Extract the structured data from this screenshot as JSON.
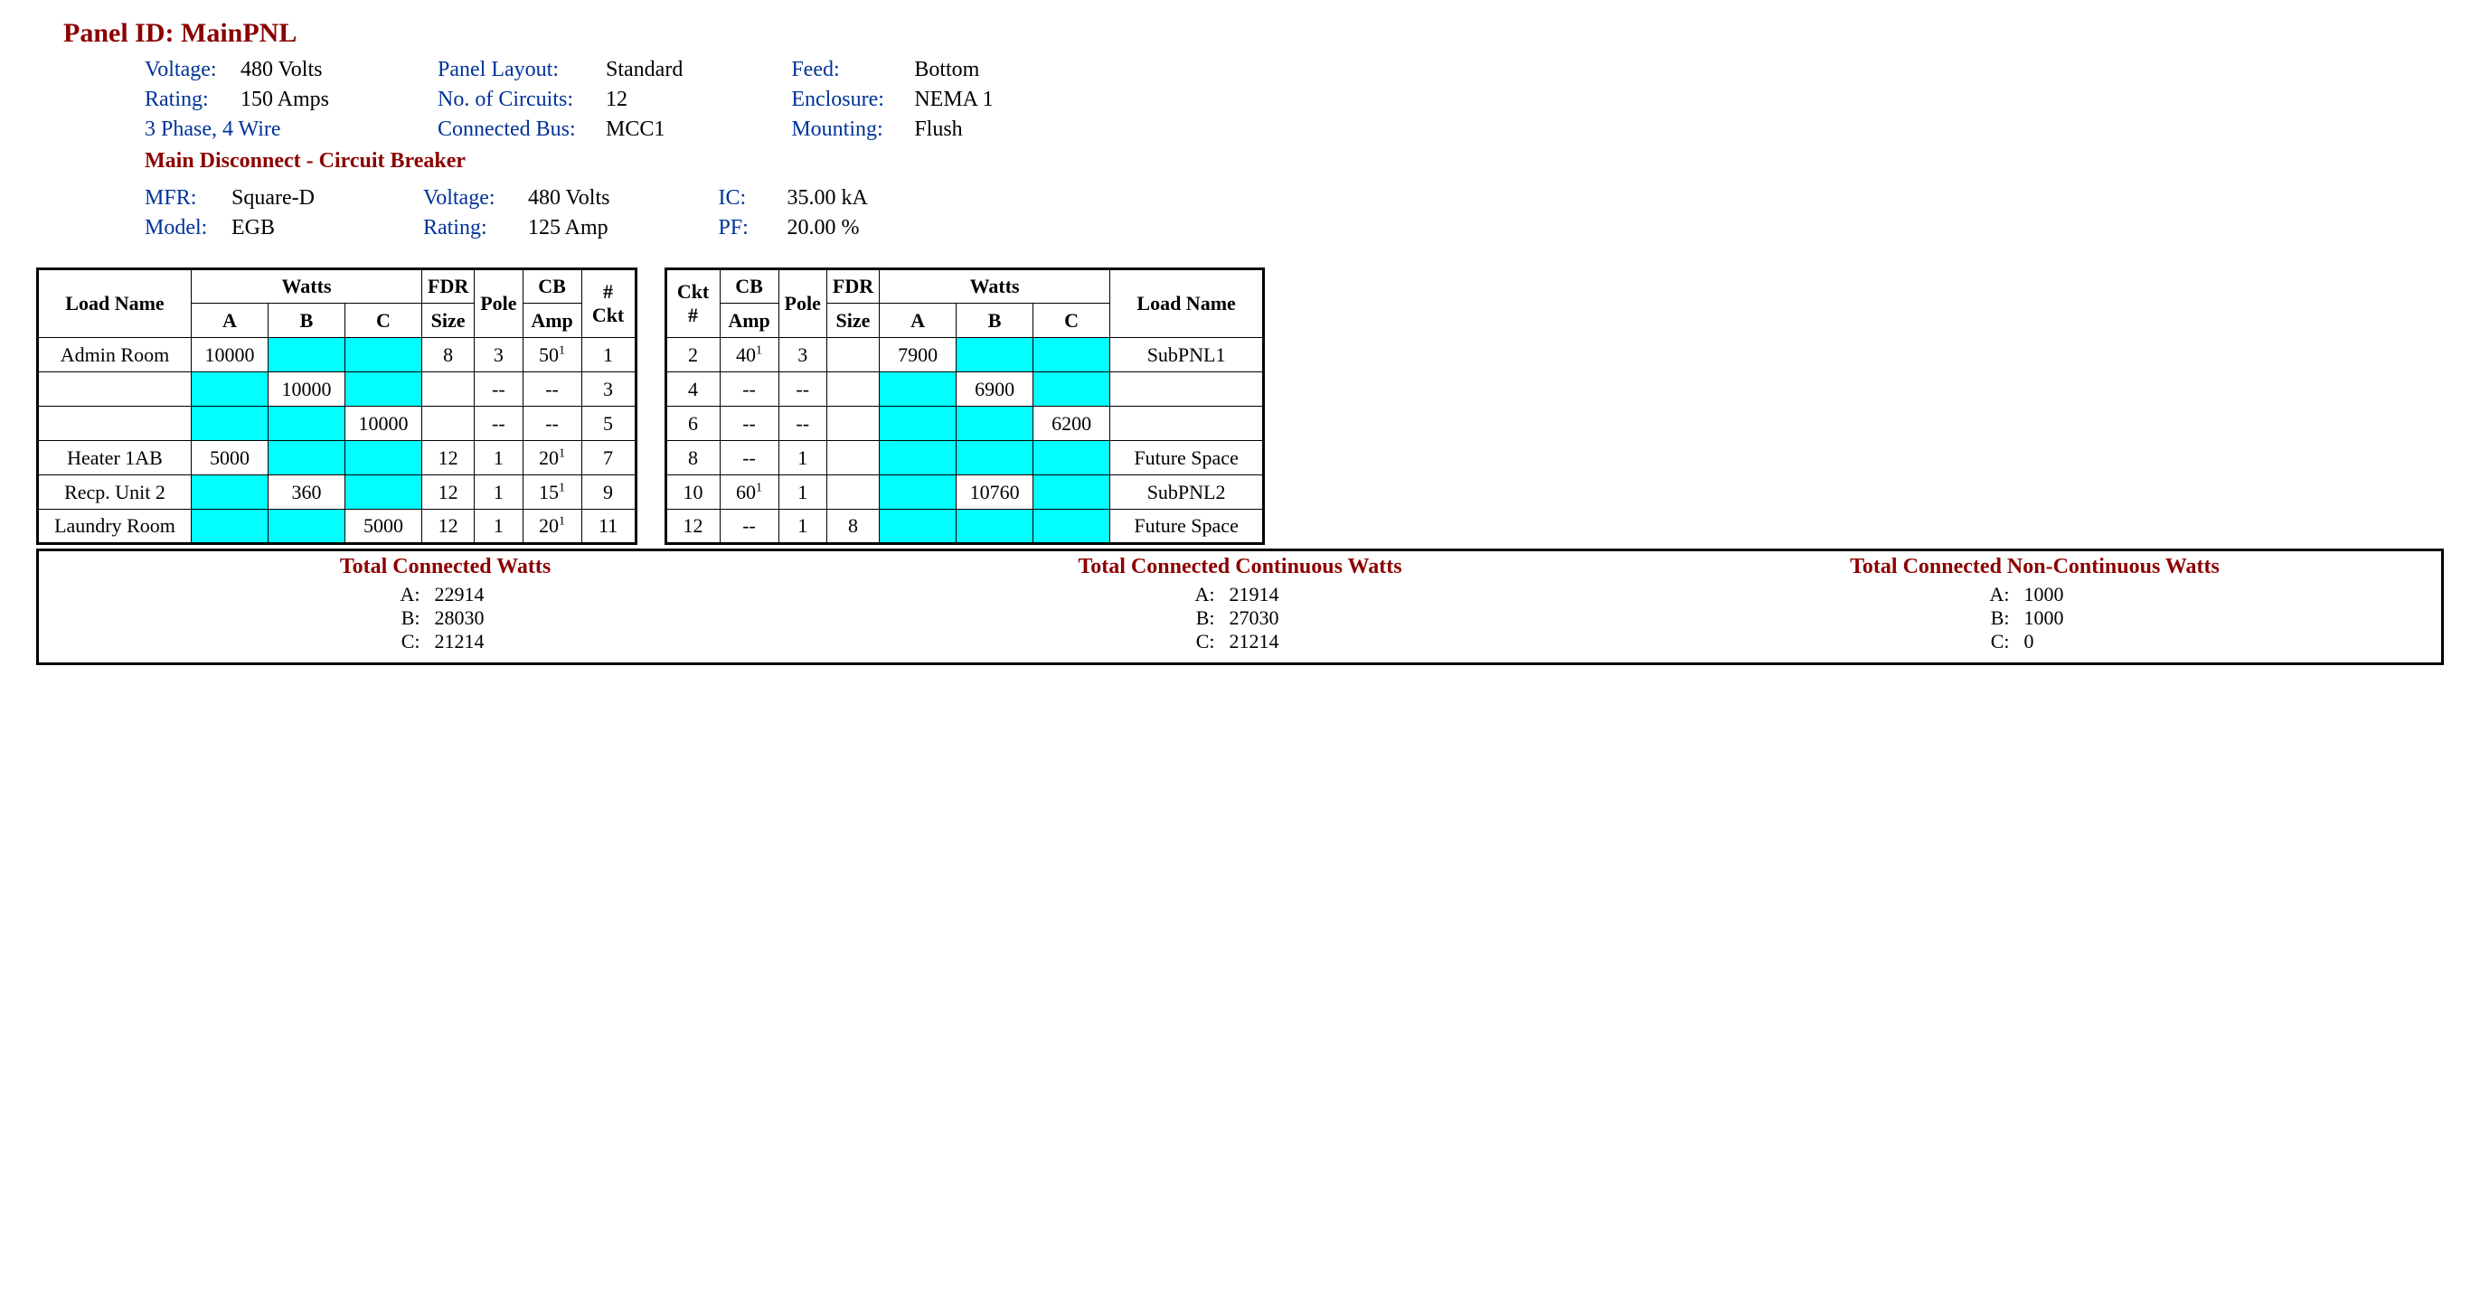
{
  "title_prefix": "Panel ID:  ",
  "title_value": "MainPNL",
  "header": {
    "col1": {
      "voltage_label": "Voltage:",
      "voltage_value": "480 Volts",
      "rating_label": "Rating:",
      "rating_value": "150 Amps",
      "phase_wire": "3 Phase, 4 Wire"
    },
    "col2": {
      "layout_label": "Panel Layout:",
      "layout_value": "Standard",
      "circuits_label": "No. of Circuits:",
      "circuits_value": "12",
      "bus_label": "Connected Bus:",
      "bus_value": "MCC1"
    },
    "col3": {
      "feed_label": "Feed:",
      "feed_value": "Bottom",
      "enclosure_label": "Enclosure:",
      "enclosure_value": "NEMA 1",
      "mounting_label": "Mounting:",
      "mounting_value": "Flush"
    }
  },
  "disconnect_title": "Main Disconnect - Circuit Breaker",
  "disconnect": {
    "col1": {
      "mfr_label": "MFR:",
      "mfr_value": "Square-D",
      "model_label": "Model:",
      "model_value": "EGB"
    },
    "col2": {
      "voltage_label": "Voltage:",
      "voltage_value": "480 Volts",
      "rating_label": "Rating:",
      "rating_value": "125 Amp"
    },
    "col3": {
      "ic_label": "IC:",
      "ic_value": "35.00 kA",
      "pf_label": "PF:",
      "pf_value": "20.00 %"
    }
  },
  "table_headers": {
    "load_name": "Load Name",
    "watts": "Watts",
    "A": "A",
    "B": "B",
    "C": "C",
    "fdr": "FDR",
    "size": "Size",
    "pole": "Pole",
    "cb": "CB",
    "amp": "Amp",
    "ckt_hash": "# Ckt",
    "ckt_num": "Ckt #"
  },
  "left_rows": [
    {
      "load": "Admin Room",
      "A": "10000",
      "B": "",
      "C": "",
      "fill": "A",
      "fdr": "8",
      "pole": "3",
      "cb": "50",
      "cb_sup": "1",
      "ckt": "1"
    },
    {
      "load": "",
      "A": "",
      "B": "10000",
      "C": "",
      "fill": "B",
      "fdr": "",
      "pole": "--",
      "cb": "--",
      "cb_sup": "",
      "ckt": "3"
    },
    {
      "load": "",
      "A": "",
      "B": "",
      "C": "10000",
      "fill": "C",
      "fdr": "",
      "pole": "--",
      "cb": "--",
      "cb_sup": "",
      "ckt": "5"
    },
    {
      "load": "Heater 1AB",
      "A": "5000",
      "B": "",
      "C": "",
      "fill": "A",
      "fdr": "12",
      "pole": "1",
      "cb": "20",
      "cb_sup": "1",
      "ckt": "7"
    },
    {
      "load": "Recp. Unit 2",
      "A": "",
      "B": "360",
      "C": "",
      "fill": "B",
      "fdr": "12",
      "pole": "1",
      "cb": "15",
      "cb_sup": "1",
      "ckt": "9"
    },
    {
      "load": "Laundry Room",
      "A": "",
      "B": "",
      "C": "5000",
      "fill": "C",
      "fdr": "12",
      "pole": "1",
      "cb": "20",
      "cb_sup": "1",
      "ckt": "11"
    }
  ],
  "right_rows": [
    {
      "ckt": "2",
      "cb": "40",
      "cb_sup": "1",
      "pole": "3",
      "fdr": "",
      "A": "7900",
      "B": "",
      "C": "",
      "fill": "A",
      "load": "SubPNL1"
    },
    {
      "ckt": "4",
      "cb": "--",
      "cb_sup": "",
      "pole": "--",
      "fdr": "",
      "A": "",
      "B": "6900",
      "C": "",
      "fill": "B",
      "load": ""
    },
    {
      "ckt": "6",
      "cb": "--",
      "cb_sup": "",
      "pole": "--",
      "fdr": "",
      "A": "",
      "B": "",
      "C": "6200",
      "fill": "C",
      "load": ""
    },
    {
      "ckt": "8",
      "cb": "--",
      "cb_sup": "",
      "pole": "1",
      "fdr": "",
      "A": "",
      "B": "",
      "C": "",
      "fill": "ALL",
      "load": "Future Space"
    },
    {
      "ckt": "10",
      "cb": "60",
      "cb_sup": "1",
      "pole": "1",
      "fdr": "",
      "A": "",
      "B": "10760",
      "C": "",
      "fill": "B",
      "load": "SubPNL2"
    },
    {
      "ckt": "12",
      "cb": "--",
      "cb_sup": "",
      "pole": "1",
      "fdr": "8",
      "A": "",
      "B": "",
      "C": "",
      "fill": "ALL",
      "load": "Future Space"
    }
  ],
  "totals": {
    "connected": {
      "title": "Total Connected Watts",
      "A": "22914",
      "B": "28030",
      "C": "21214"
    },
    "continuous": {
      "title": "Total Connected Continuous Watts",
      "A": "21914",
      "B": "27030",
      "C": "21214"
    },
    "noncontinuous": {
      "title": "Total Connected Non-Continuous Watts",
      "A": "1000",
      "B": "1000",
      "C": "0"
    }
  },
  "labels": {
    "A": "A:",
    "B": "B:",
    "C": "C:"
  }
}
